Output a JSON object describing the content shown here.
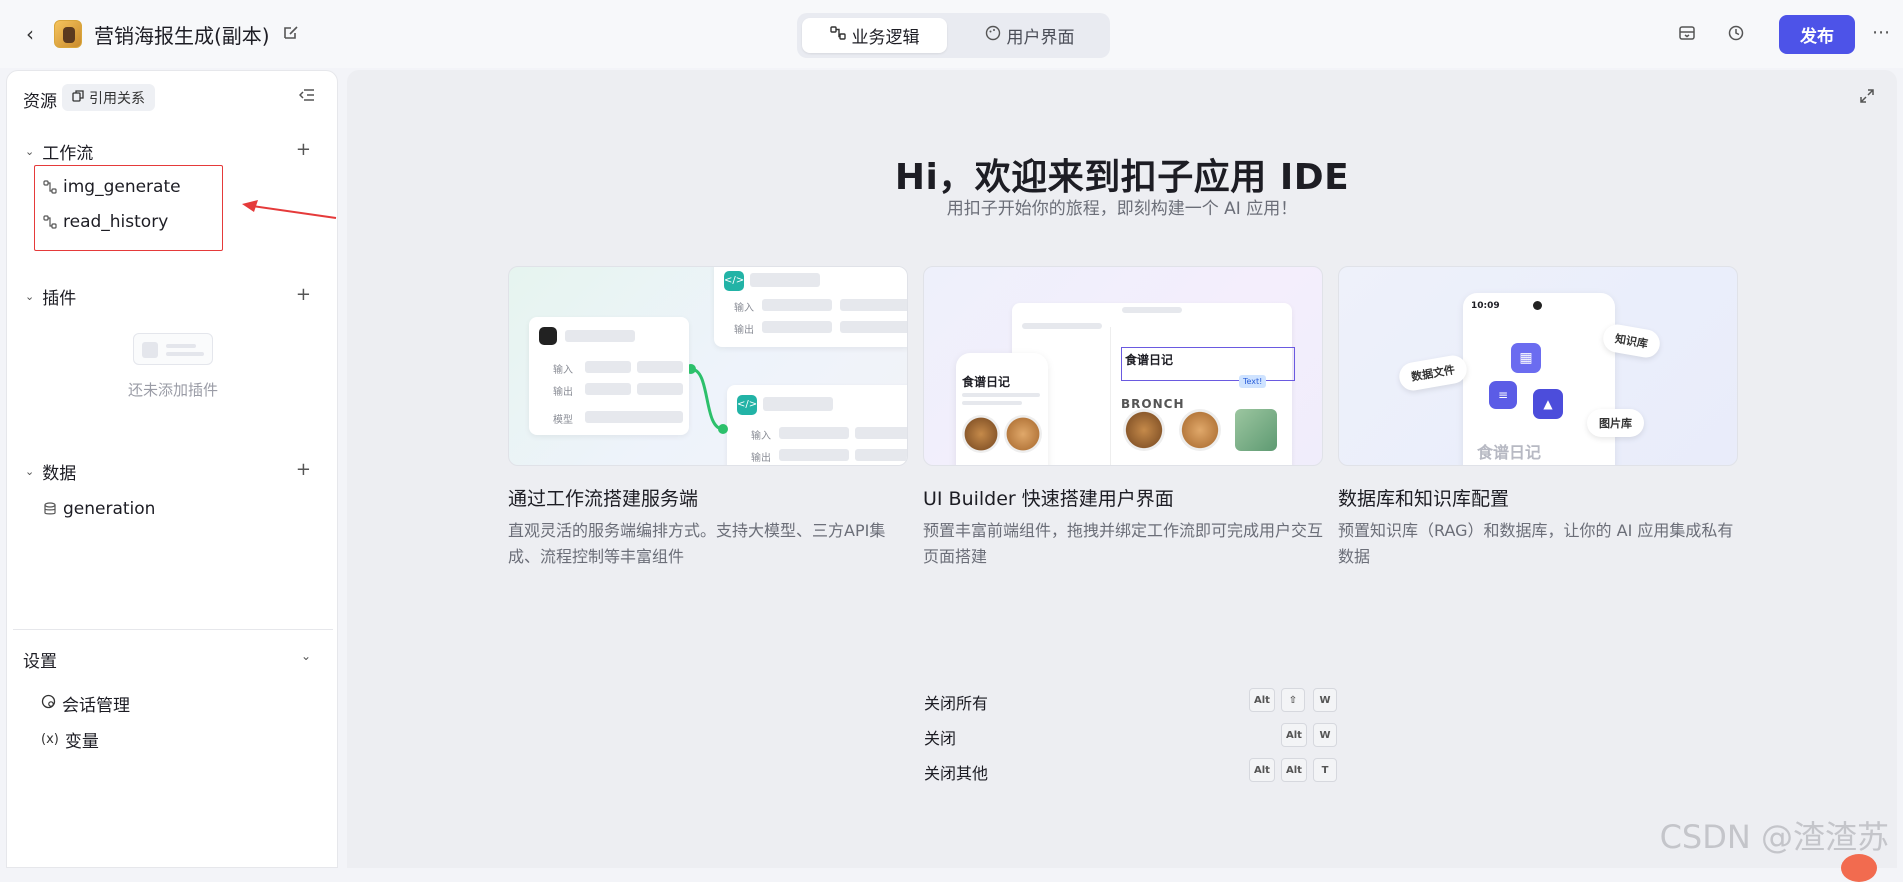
{
  "header": {
    "app_title": "营销海报生成(副本)",
    "tabs": [
      {
        "label": "业务逻辑",
        "active": true
      },
      {
        "label": "用户界面",
        "active": false
      }
    ],
    "publish_label": "发布",
    "accent": "#4d53e8"
  },
  "sidebar": {
    "resources_title": "资源",
    "reference_chip": "引用关系",
    "workflow": {
      "title": "工作流",
      "items": [
        "img_generate",
        "read_history"
      ]
    },
    "plugins": {
      "title": "插件",
      "empty_text": "还未添加插件"
    },
    "data": {
      "title": "数据",
      "items": [
        "generation"
      ]
    },
    "settings": {
      "title": "设置",
      "items": [
        {
          "label": "会话管理",
          "icon": "chat-settings-icon"
        },
        {
          "label": "变量",
          "icon": "variable-icon",
          "icon_text": "(x)"
        }
      ]
    }
  },
  "main": {
    "hero_title": "Hi，欢迎来到扣子应用 IDE",
    "hero_subtitle": "用扣子开始你的旅程，即刻构建一个 AI 应用！",
    "cards": [
      {
        "title": "通过工作流搭建服务端",
        "desc": "直观灵活的服务端编排方式。支持大模型、三方API集成、流程控制等丰富组件",
        "illustration": {
          "inputs": "输入",
          "outputs": "输出",
          "model": "模型"
        }
      },
      {
        "title": "UI Builder 快速搭建用户界面",
        "desc": "预置丰富前端组件，拖拽并绑定工作流即可完成用户交互页面搭建",
        "illustration": {
          "recipe": "食谱日记",
          "text_tag": "Text!",
          "brand": "BRONCH"
        }
      },
      {
        "title": "数据库和知识库配置",
        "desc": "预置知识库（RAG）和数据库，让你的 AI 应用集成私有数据",
        "illustration": {
          "time": "10:09",
          "pill_1": "知识库",
          "pill_2": "数据文件",
          "pill_3": "图片库",
          "recipe": "食谱日记"
        }
      }
    ],
    "shortcuts": [
      {
        "label": "关闭所有",
        "keys": [
          "Alt",
          "⇧",
          "W"
        ]
      },
      {
        "label": "关闭",
        "keys": [
          "Alt",
          "W"
        ]
      },
      {
        "label": "关闭其他",
        "keys": [
          "Alt",
          "Alt",
          "T"
        ]
      }
    ]
  },
  "watermark": "CSDN @渣渣苏"
}
